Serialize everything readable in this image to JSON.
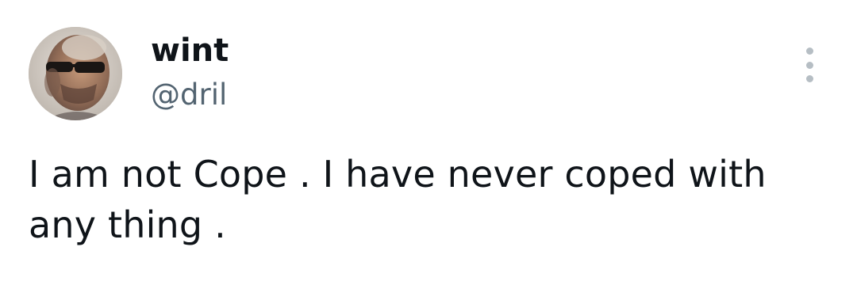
{
  "author": {
    "display_name": "wint",
    "handle": "@dril",
    "avatar_icon": "avatar-photo"
  },
  "menu": {
    "icon": "more-options-icon"
  },
  "tweet": {
    "text": "I am not Cope . I have never coped with any thing ."
  },
  "colors": {
    "text_primary": "#0f1419",
    "text_secondary": "#536471",
    "icon_muted": "#b6bec4",
    "background": "#ffffff"
  }
}
